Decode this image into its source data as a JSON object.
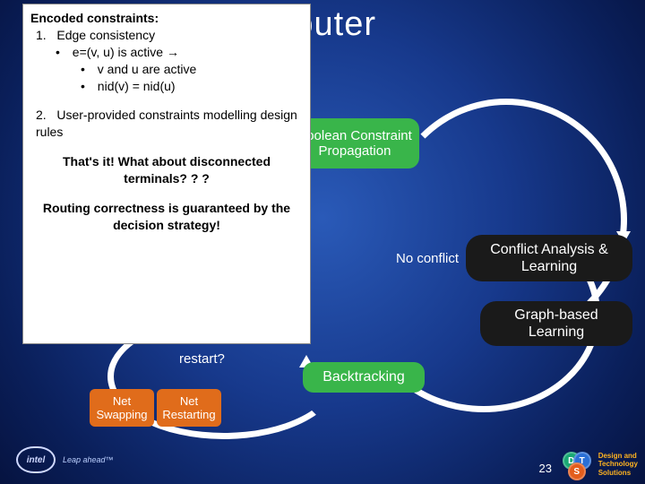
{
  "title": "Router",
  "callout": {
    "header": "Encoded constraints:",
    "item1_num": "1.",
    "item1": "Edge consistency",
    "item1_a": "e=(v, u) is active",
    "item1_a_arrow": "→",
    "item1_a_i": "v and u are active",
    "item1_a_ii": "nid(v) = nid(u)",
    "item2_num": "2.",
    "item2": "User-provided constraints modelling design rules",
    "q1": "That's it! What about disconnected terminals? ? ?",
    "q2": "Routing correctness is guaranteed by the decision strategy!"
  },
  "blocks": {
    "bcp": "Boolean Constraint Propagation",
    "backtracking": "Backtracking",
    "net_swapping_l1": "Net",
    "net_swapping_l2": "Swapping",
    "net_restarting_l1": "Net",
    "net_restarting_l2": "Restarting",
    "conflict_analysis": "Conflict Analysis & Learning",
    "graph_learning": "Graph-based Learning"
  },
  "edges": {
    "no_conflict": "No conflict",
    "restart_q": "restart?"
  },
  "footer": {
    "intel": "intel",
    "leap": "Leap ahead™",
    "page": "23",
    "dt_d": "D",
    "dt_t": "T",
    "dt_s": "S",
    "dt_line1": "Design and",
    "dt_line2": "Technology",
    "dt_line3": "Solutions"
  }
}
